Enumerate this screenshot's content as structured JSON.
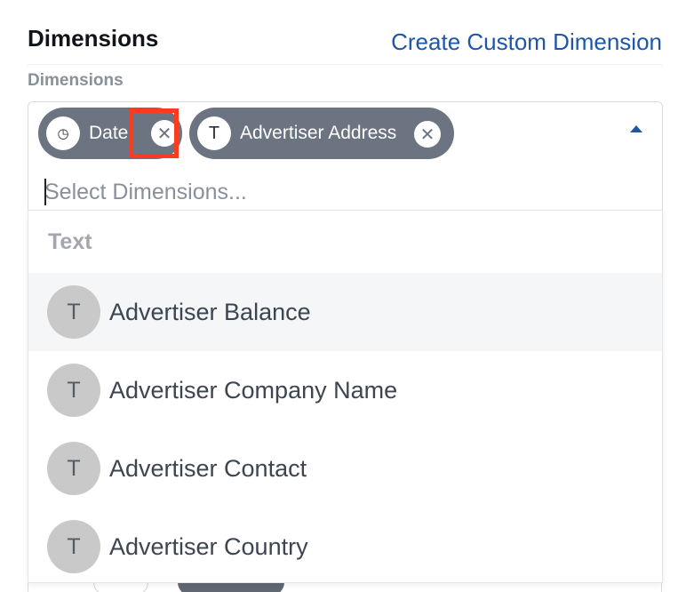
{
  "section": {
    "title": "Dimensions",
    "create_link": "Create Custom Dimension",
    "field_label": "Dimensions"
  },
  "selector": {
    "placeholder": "Select Dimensions...",
    "chips": [
      {
        "icon": "clock-icon",
        "icon_glyph": "◷",
        "label": "Date",
        "remove_glyph": "✕"
      },
      {
        "icon": "text-type-icon",
        "icon_glyph": "T",
        "label": "Advertiser Address",
        "remove_glyph": "✕"
      }
    ]
  },
  "dropdown": {
    "group_label": "Text",
    "options": [
      {
        "icon_glyph": "T",
        "label": "Advertiser Balance",
        "active": true
      },
      {
        "icon_glyph": "T",
        "label": "Advertiser Company Name",
        "active": false
      },
      {
        "icon_glyph": "T",
        "label": "Advertiser Contact",
        "active": false
      },
      {
        "icon_glyph": "T",
        "label": "Advertiser Country",
        "active": false
      }
    ]
  },
  "colors": {
    "link": "#1f56a8",
    "chip": "#6b7480",
    "highlight": "#ff3b1f"
  }
}
